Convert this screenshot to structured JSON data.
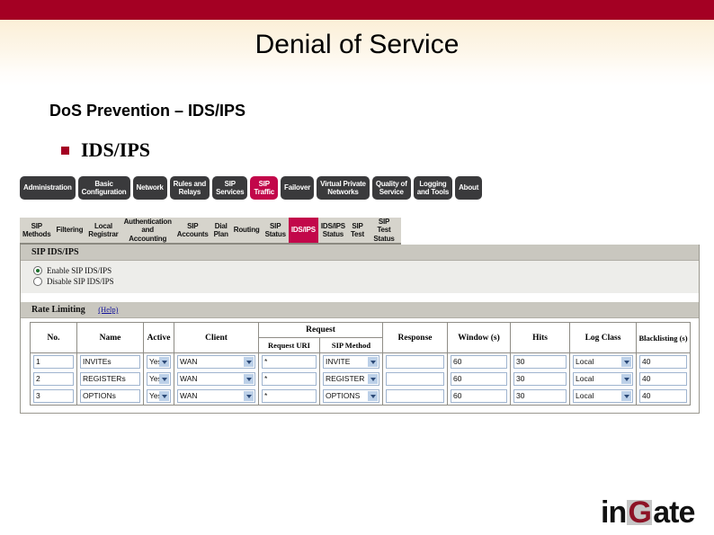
{
  "slide": {
    "title": "Denial of Service",
    "subtitle": "DoS Prevention – IDS/IPS",
    "bullet": "IDS/IPS",
    "accent_color": "#a40023",
    "logo": {
      "pre": "in",
      "mid": "G",
      "post": "ate"
    }
  },
  "app": {
    "main_nav": [
      {
        "label": "Administration",
        "active": false
      },
      {
        "label": "Basic\nConfiguration",
        "active": false
      },
      {
        "label": "Network",
        "active": false
      },
      {
        "label": "Rules and\nRelays",
        "active": false
      },
      {
        "label": "SIP\nServices",
        "active": false
      },
      {
        "label": "SIP\nTraffic",
        "active": true
      },
      {
        "label": "Failover",
        "active": false
      },
      {
        "label": "Virtual Private\nNetworks",
        "active": false
      },
      {
        "label": "Quality of\nService",
        "active": false
      },
      {
        "label": "Logging\nand Tools",
        "active": false
      },
      {
        "label": "About",
        "active": false
      }
    ],
    "sub_nav": [
      {
        "label": "SIP\nMethods",
        "active": false
      },
      {
        "label": "Filtering",
        "active": false
      },
      {
        "label": "Local\nRegistrar",
        "active": false
      },
      {
        "label": "Authentication\nand Accounting",
        "active": false
      },
      {
        "label": "SIP\nAccounts",
        "active": false
      },
      {
        "label": "Dial\nPlan",
        "active": false
      },
      {
        "label": "Routing",
        "active": false
      },
      {
        "label": "SIP\nStatus",
        "active": false
      },
      {
        "label": "IDS/IPS",
        "active": true
      },
      {
        "label": "IDS/IPS\nStatus",
        "active": false
      },
      {
        "label": "SIP\nTest",
        "active": false
      },
      {
        "label": "SIP\nTest Status",
        "active": false
      }
    ],
    "ids_section": {
      "heading": "SIP IDS/IPS",
      "options": [
        {
          "label": "Enable SIP IDS/IPS",
          "selected": true
        },
        {
          "label": "Disable SIP IDS/IPS",
          "selected": false
        }
      ]
    },
    "rate_limiting": {
      "heading": "Rate Limiting",
      "help": "(Help)",
      "columns": {
        "no": "No.",
        "name": "Name",
        "active": "Active",
        "client": "Client",
        "request": "Request",
        "request_uri": "Request URI",
        "sip_method": "SIP Method",
        "response": "Response",
        "window": "Window (s)",
        "hits": "Hits",
        "log_class": "Log Class",
        "blacklisting": "Blacklisting (s)"
      },
      "rows": [
        {
          "no": "1",
          "name": "INVITEs",
          "active": "Yes",
          "client": "WAN",
          "request_uri": "*",
          "sip_method": "INVITE",
          "response": "",
          "window": "60",
          "hits": "30",
          "log_class": "Local",
          "blacklisting": "40"
        },
        {
          "no": "2",
          "name": "REGISTERs",
          "active": "Yes",
          "client": "WAN",
          "request_uri": "*",
          "sip_method": "REGISTER",
          "response": "",
          "window": "60",
          "hits": "30",
          "log_class": "Local",
          "blacklisting": "40"
        },
        {
          "no": "3",
          "name": "OPTIONs",
          "active": "Yes",
          "client": "WAN",
          "request_uri": "*",
          "sip_method": "OPTIONS",
          "response": "",
          "window": "60",
          "hits": "30",
          "log_class": "Local",
          "blacklisting": "40"
        }
      ]
    }
  }
}
